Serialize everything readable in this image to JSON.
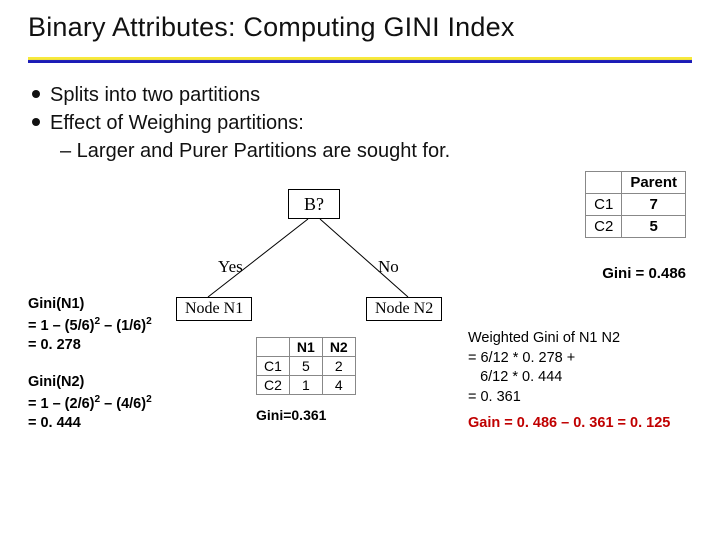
{
  "title": "Binary Attributes: Computing GINI Index",
  "bullets": {
    "b1": "Splits into two partitions",
    "b2": "Effect of Weighing partitions:",
    "sub": "–  Larger and Purer Partitions are sought for."
  },
  "tree": {
    "root": "B?",
    "yes": "Yes",
    "no": "No",
    "n1": "Node N1",
    "n2": "Node N2"
  },
  "gini_n1": {
    "l1": "Gini(N1)",
    "l2_pre": "= 1 – (5/6)",
    "l2_mid": " – (1/6)",
    "l3": "= 0. 278"
  },
  "gini_n2": {
    "l1": "Gini(N2)",
    "l2_pre": "= 1 – (2/6)",
    "l2_mid": " – (4/6)",
    "l3": "= 0. 444"
  },
  "parent_table": {
    "head": "Parent",
    "r1c1": "C1",
    "r1c2": "7",
    "r2c1": "C2",
    "r2c2": "5"
  },
  "parent_gini": "Gini = 0.486",
  "node_table": {
    "h1": "N1",
    "h2": "N2",
    "r1c0": "C1",
    "r1c1": "5",
    "r1c2": "2",
    "r2c0": "C2",
    "r2c1": "1",
    "r2c2": "4"
  },
  "node_gini": "Gini=0.361",
  "weighted": {
    "l1": "Weighted Gini of N1 N2",
    "l2": "= 6/12 * 0. 278 +",
    "l3": "   6/12 * 0. 444",
    "l4": "= 0. 361"
  },
  "gain": "Gain = 0. 486 – 0. 361 = 0. 125",
  "chart_data": {
    "type": "table",
    "parent": {
      "C1": 7,
      "C2": 5,
      "gini": 0.486
    },
    "nodes": {
      "N1": {
        "C1": 5,
        "C2": 1,
        "gini": 0.278,
        "weight": 0.5
      },
      "N2": {
        "C1": 2,
        "C2": 4,
        "gini": 0.444,
        "weight": 0.5
      }
    },
    "weighted_gini": 0.361,
    "gain": 0.125
  }
}
